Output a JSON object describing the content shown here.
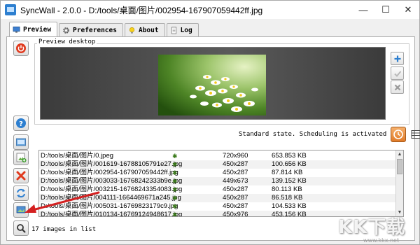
{
  "window": {
    "title": "SyncWall - 2.0.0 - D:/tools/桌面/图片/002954-167907059442ff.jpg",
    "controls": {
      "minimize": "—",
      "maximize": "☐",
      "close": "✕"
    }
  },
  "tabs": [
    {
      "label": "Preview",
      "icon": "monitor-icon",
      "active": true
    },
    {
      "label": "Preferences",
      "icon": "gear-icon",
      "active": false
    },
    {
      "label": "About",
      "icon": "lightbulb-icon",
      "active": false
    },
    {
      "label": "Log",
      "icon": "log-icon",
      "active": false
    }
  ],
  "preview": {
    "group_label": "Preview desktop"
  },
  "status": {
    "text": "Standard state. Scheduling is activated"
  },
  "file_list": {
    "rows": [
      {
        "name": "D:/tools/桌面/图片/0.jpeg",
        "dimensions": "720x960",
        "size": "653.853 KB"
      },
      {
        "name": "D:/tools/桌面/图片/001619-16788105791e27.jpg",
        "dimensions": "450x287",
        "size": "100.656 KB"
      },
      {
        "name": "D:/tools/桌面/图片/002954-167907059442ff.jpg",
        "dimensions": "450x287",
        "size": "87.814 KB"
      },
      {
        "name": "D:/tools/桌面/图片/003033-16768242333b9e.jpg",
        "dimensions": "449x673",
        "size": "139.152 KB"
      },
      {
        "name": "D:/tools/桌面/图片/003215-16768243354083.jpg",
        "dimensions": "450x287",
        "size": "80.113 KB"
      },
      {
        "name": "D:/tools/桌面/图片/004111-1664469671a245.jpg",
        "dimensions": "450x287",
        "size": "86.518 KB"
      },
      {
        "name": "D:/tools/桌面/图片/005031-16769823179c9.jpg",
        "dimensions": "450x287",
        "size": "104.533 KB"
      },
      {
        "name": "D:/tools/桌面/图片/010134-16769124948617.jpg",
        "dimensions": "450x976",
        "size": "453.156 KB"
      }
    ]
  },
  "count": {
    "text": "17 images in list"
  },
  "watermark": {
    "logo_text": "KK下载",
    "url": "www.kkx.net"
  },
  "colors": {
    "accent_red": "#e03a1e",
    "accent_blue": "#2d7fd0",
    "schedule_orange": "#e07b28",
    "star_green": "#3a7a1a"
  }
}
